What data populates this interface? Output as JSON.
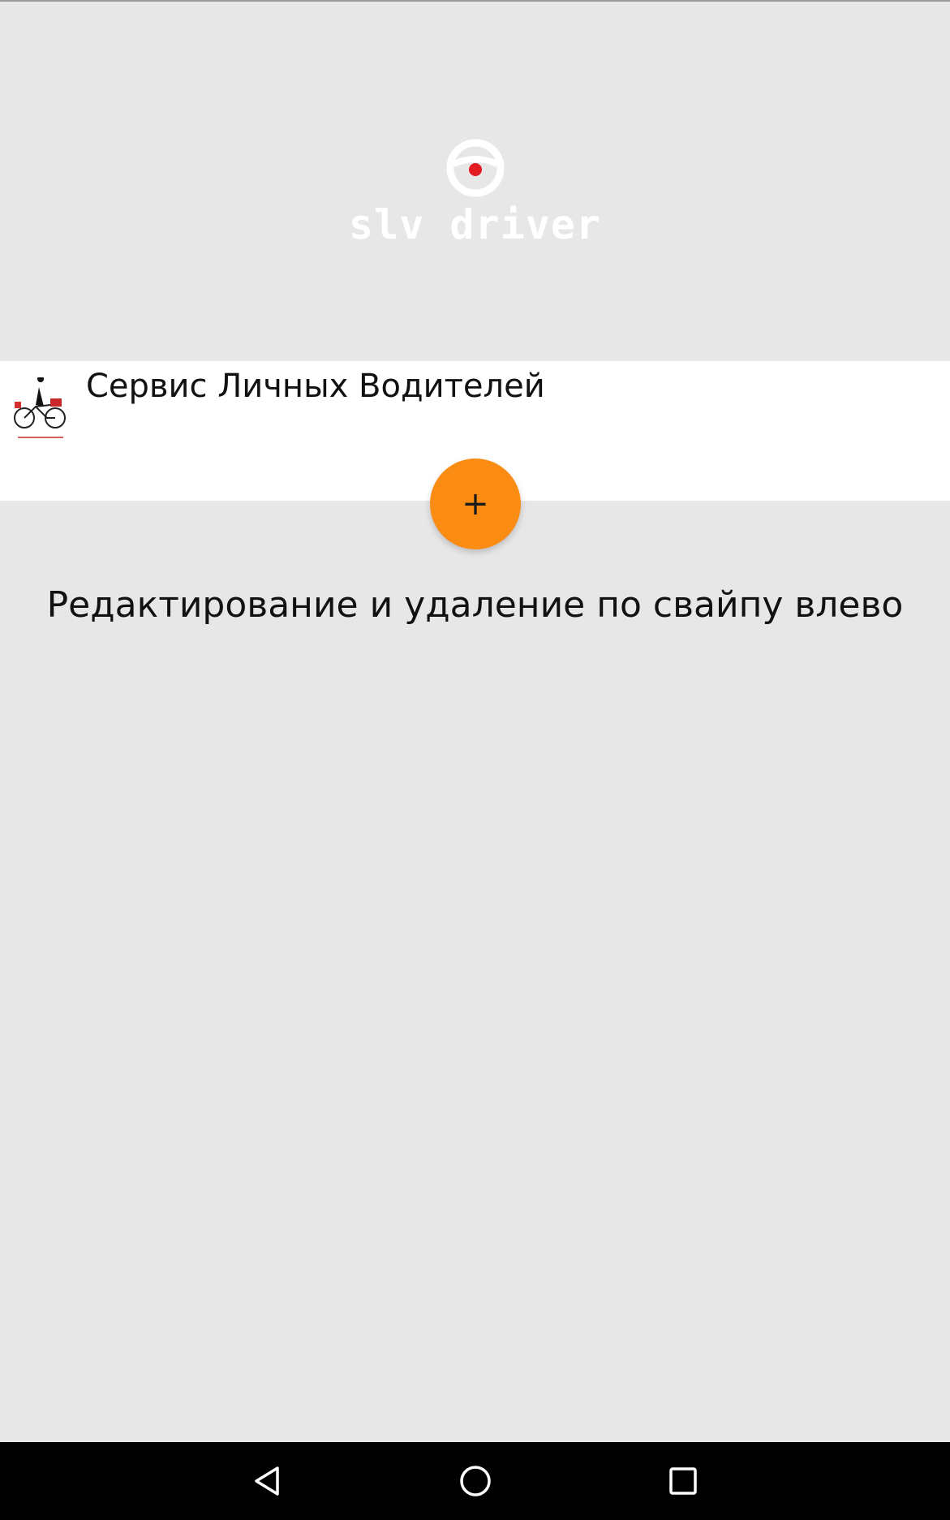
{
  "app": {
    "logo_text": "slv driver",
    "accent_dot_color": "#e31b23",
    "fab_color": "#fb8c13"
  },
  "list": {
    "items": [
      {
        "title": "Сервис Личных Водителей",
        "thumb_icon": "cyclist-logo-icon"
      }
    ]
  },
  "fab": {
    "label": "+"
  },
  "hint_text": "Редактирование и удаление по свайпу влево",
  "navigation_bar": {
    "back_icon": "back-triangle-icon",
    "home_icon": "home-circle-icon",
    "recents_icon": "recents-square-icon"
  }
}
